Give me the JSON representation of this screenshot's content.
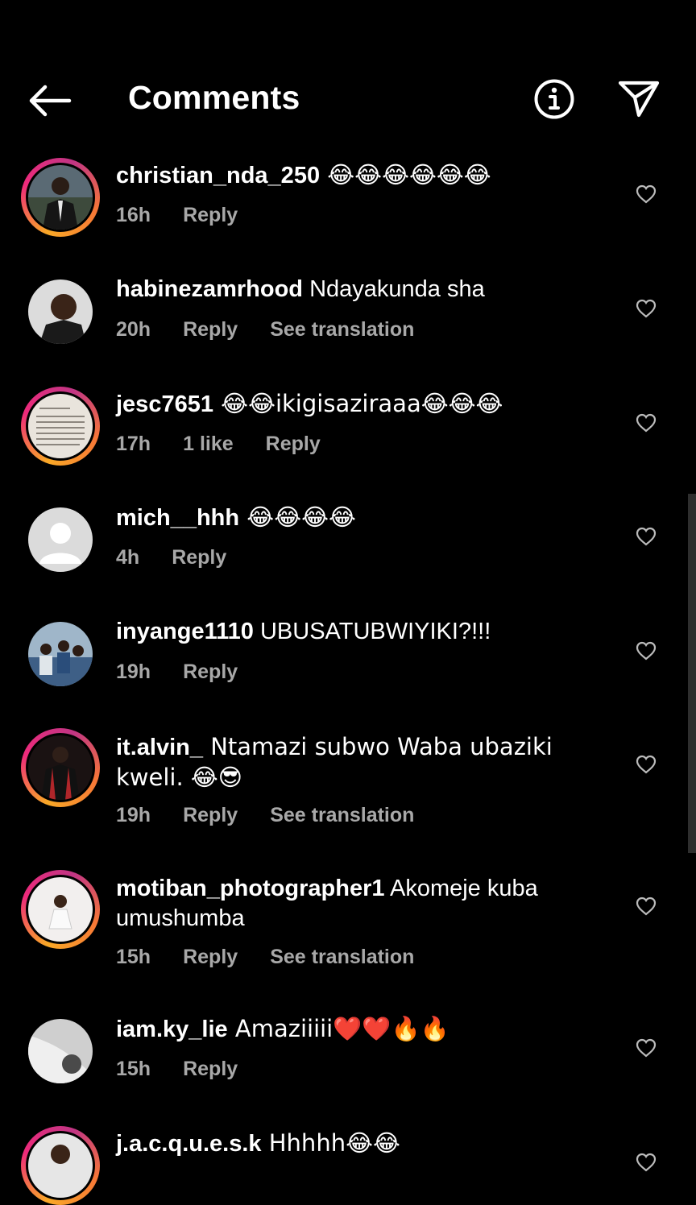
{
  "header": {
    "title": "Comments",
    "back_icon": "arrow-left-icon",
    "info_icon": "info-circle-icon",
    "share_icon": "paper-plane-icon"
  },
  "actions": {
    "reply": "Reply",
    "see_translation": "See translation"
  },
  "comments": [
    {
      "username": "christian_nda_250",
      "text": " 😂😂😂😂😂😂",
      "time": "16h",
      "likes": "",
      "translation": ""
    },
    {
      "username": "habinezamrhood",
      "text": " Ndayakunda sha",
      "time": "20h",
      "likes": "",
      "translation": "See translation"
    },
    {
      "username": "jesc7651",
      "text": " 😂😂ikigisaziraaa😂😂😂",
      "time": "17h",
      "likes": "1 like",
      "translation": ""
    },
    {
      "username": "mich__hhh",
      "text": " 😂😂😂😂",
      "time": "4h",
      "likes": "",
      "translation": ""
    },
    {
      "username": "inyange1110",
      "text": " UBUSATUBWIYIKI?!!!",
      "time": "19h",
      "likes": "",
      "translation": ""
    },
    {
      "username": "it.alvin_",
      "text": " Ntamazi subwo Waba ubaziki kweli. 😂😎",
      "time": "19h",
      "likes": "",
      "translation": "See translation"
    },
    {
      "username": "motiban_photographer1",
      "text": " Akomeje kuba umushumba",
      "time": "15h",
      "likes": "",
      "translation": "See translation"
    },
    {
      "username": "iam.ky_lie",
      "text": " Amaziiiii❤️❤️🔥🔥",
      "time": "15h",
      "likes": "",
      "translation": ""
    },
    {
      "username": "j.a.c.q.u.e.s.k",
      "text": " Hhhhh😂😂",
      "time": "",
      "likes": "",
      "translation": ""
    }
  ],
  "colors": {
    "background": "#000000",
    "meta_text": "#a8a8a8",
    "ring_start": "#f9a826",
    "ring_end": "#c13584"
  }
}
